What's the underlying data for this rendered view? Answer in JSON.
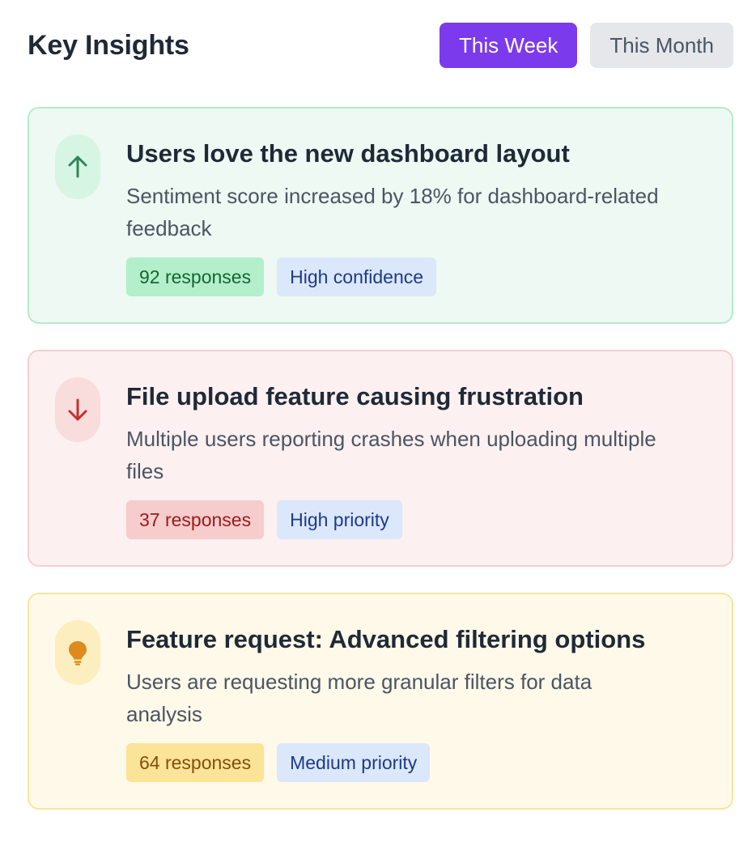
{
  "header": {
    "title": "Key Insights",
    "toggles": [
      {
        "label": "This Week",
        "active": true
      },
      {
        "label": "This Month",
        "active": false
      }
    ]
  },
  "insights": [
    {
      "variant": "positive",
      "icon": "arrow-up-icon",
      "title": "Users love the new dashboard layout",
      "description": "Sentiment score increased by 18% for dashboard-related feedback",
      "responses": "92 responses",
      "label": "High confidence"
    },
    {
      "variant": "negative",
      "icon": "arrow-down-icon",
      "title": "File upload feature causing frustration",
      "description": "Multiple users reporting crashes when uploading multiple files",
      "responses": "37 responses",
      "label": "High priority"
    },
    {
      "variant": "idea",
      "icon": "lightbulb-icon",
      "title": "Feature request: Advanced filtering options",
      "description": "Users are requesting more granular filters for data analysis",
      "responses": "64 responses",
      "label": "Medium priority"
    }
  ],
  "colors": {
    "accent": "#7c3aed",
    "positive": "#2f855a",
    "negative": "#c53030",
    "idea": "#dd8a1f"
  }
}
